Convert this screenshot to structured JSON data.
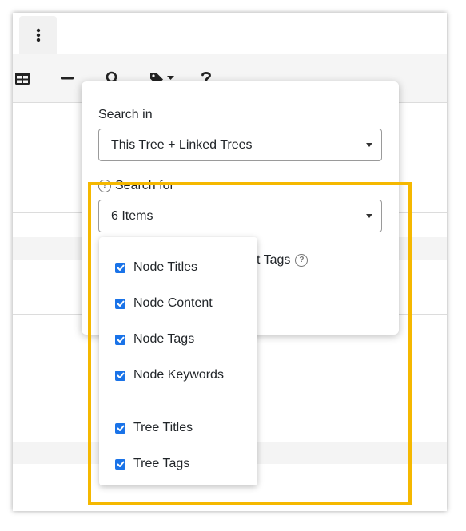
{
  "tabbar": {
    "more_icon": "vertical-ellipsis-icon"
  },
  "toolbar": {
    "buttons": [
      {
        "icon": "table-icon"
      },
      {
        "icon": "minus-icon"
      },
      {
        "icon": "search-icon"
      },
      {
        "icon": "tag-icon"
      },
      {
        "icon": "help-icon"
      }
    ]
  },
  "search_popover": {
    "search_in_label": "Search in",
    "search_in_value": "This Tree + Linked Trees",
    "search_for_label": "Search for",
    "search_for_value": "6 Items",
    "partial_tags_label": "t Tags"
  },
  "search_for_dropdown": {
    "items": [
      {
        "label": "Node Titles",
        "checked": true
      },
      {
        "label": "Node Content",
        "checked": true
      },
      {
        "label": "Node Tags",
        "checked": true
      },
      {
        "label": "Node Keywords",
        "checked": true
      },
      {
        "label": "Tree Titles",
        "checked": true
      },
      {
        "label": "Tree Tags",
        "checked": true
      }
    ]
  },
  "colors": {
    "highlight": "#f5b800",
    "checkbox": "#1a73e8"
  }
}
